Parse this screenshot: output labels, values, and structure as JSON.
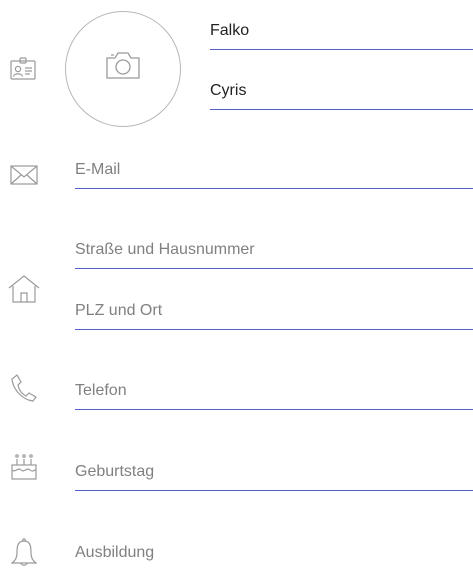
{
  "contact": {
    "first_name": "Falko",
    "last_name": "Cyris"
  },
  "fields": {
    "email_placeholder": "E-Mail",
    "street_placeholder": "Straße und Hausnummer",
    "zip_city_placeholder": "PLZ und Ort",
    "phone_placeholder": "Telefon",
    "birthday_placeholder": "Geburtstag",
    "education_placeholder": "Ausbildung"
  },
  "icons": {
    "name": "id-card-icon",
    "photo": "camera-icon",
    "email": "envelope-icon",
    "address": "house-icon",
    "phone": "phone-icon",
    "birthday": "cake-icon",
    "education": "bell-icon"
  },
  "colors": {
    "underline": "#5561c9",
    "icon": "#9a9a9a",
    "placeholder": "#808080",
    "text": "#222222"
  }
}
